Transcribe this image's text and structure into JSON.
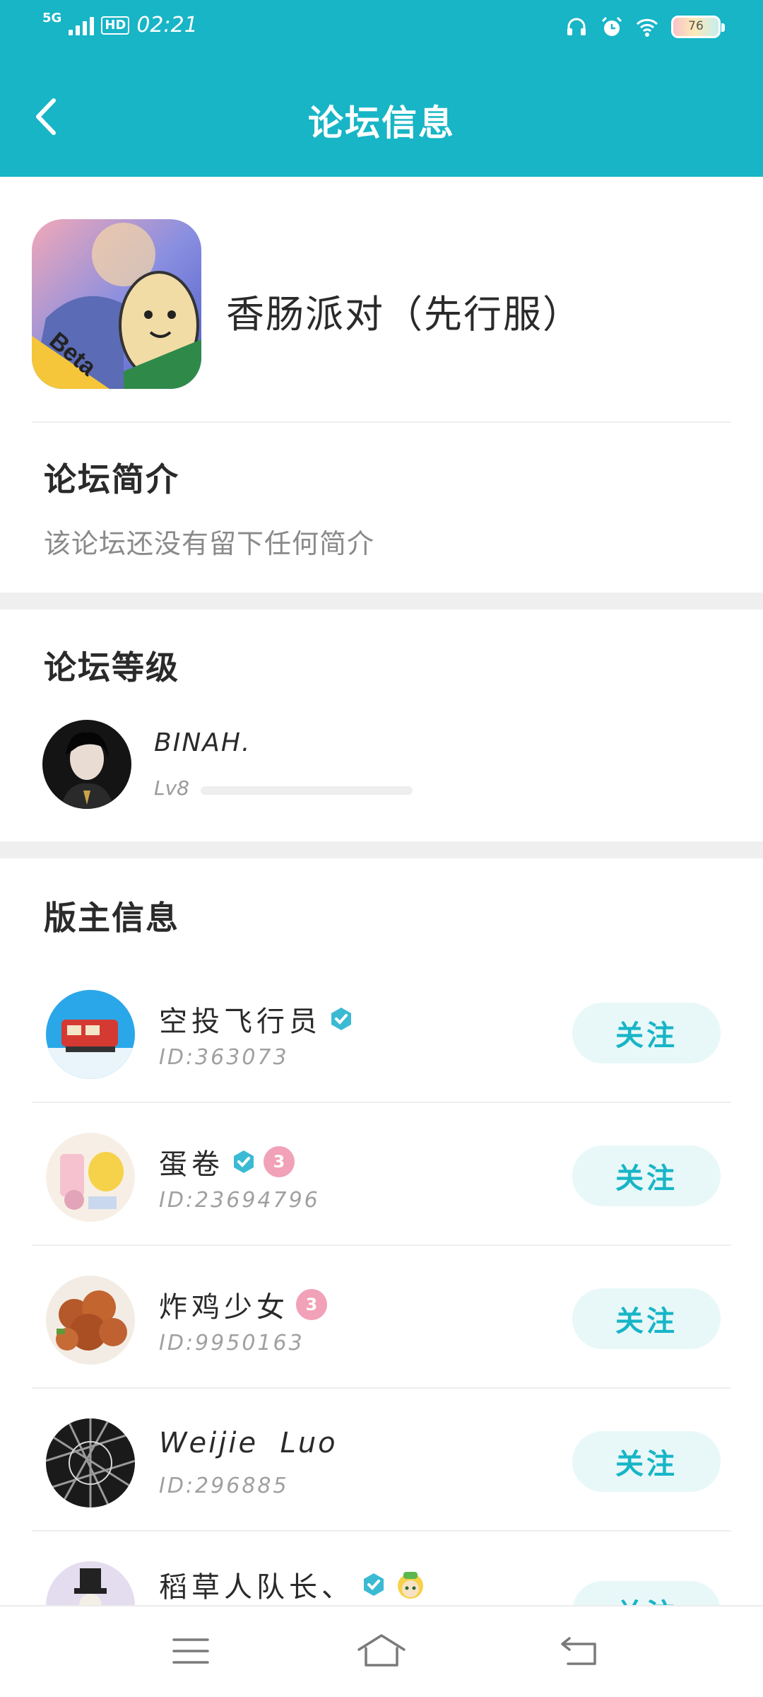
{
  "status_bar": {
    "network": "5G",
    "hd": "HD",
    "time": "02:21",
    "battery": "76"
  },
  "header": {
    "title": "论坛信息"
  },
  "forum": {
    "name": "香肠派对（先行服）",
    "icon_badge": "Beta"
  },
  "intro": {
    "title": "论坛简介",
    "text": "该论坛还没有留下任何简介"
  },
  "level": {
    "title": "论坛等级",
    "user_name": "BINAH.",
    "level_label": "Lv8",
    "progress": 0
  },
  "moderators": {
    "title": "版主信息",
    "follow_label": "关注",
    "items": [
      {
        "name": "空投飞行员",
        "id": "ID:363073",
        "verified": true,
        "level_badge": ""
      },
      {
        "name": "蛋卷",
        "id": "ID:23694796",
        "verified": true,
        "level_badge": "3"
      },
      {
        "name": "炸鸡少女",
        "id": "ID:9950163",
        "verified": false,
        "level_badge": "3"
      },
      {
        "name": "Weijie  Luo",
        "id": "ID:296885",
        "verified": false,
        "level_badge": ""
      },
      {
        "name": "稻草人队长、",
        "id": "",
        "verified": true,
        "level_badge": ""
      }
    ]
  },
  "colors": {
    "accent": "#17b5c6",
    "follow_bg": "#e8f8f9",
    "divider": "#efefef",
    "level_badge": "#f1a1b8"
  },
  "icons": {
    "back": "back-arrow-icon",
    "verified": "verified-check-icon",
    "nav_menu": "menu-icon",
    "nav_home": "home-icon",
    "nav_back": "return-icon"
  }
}
